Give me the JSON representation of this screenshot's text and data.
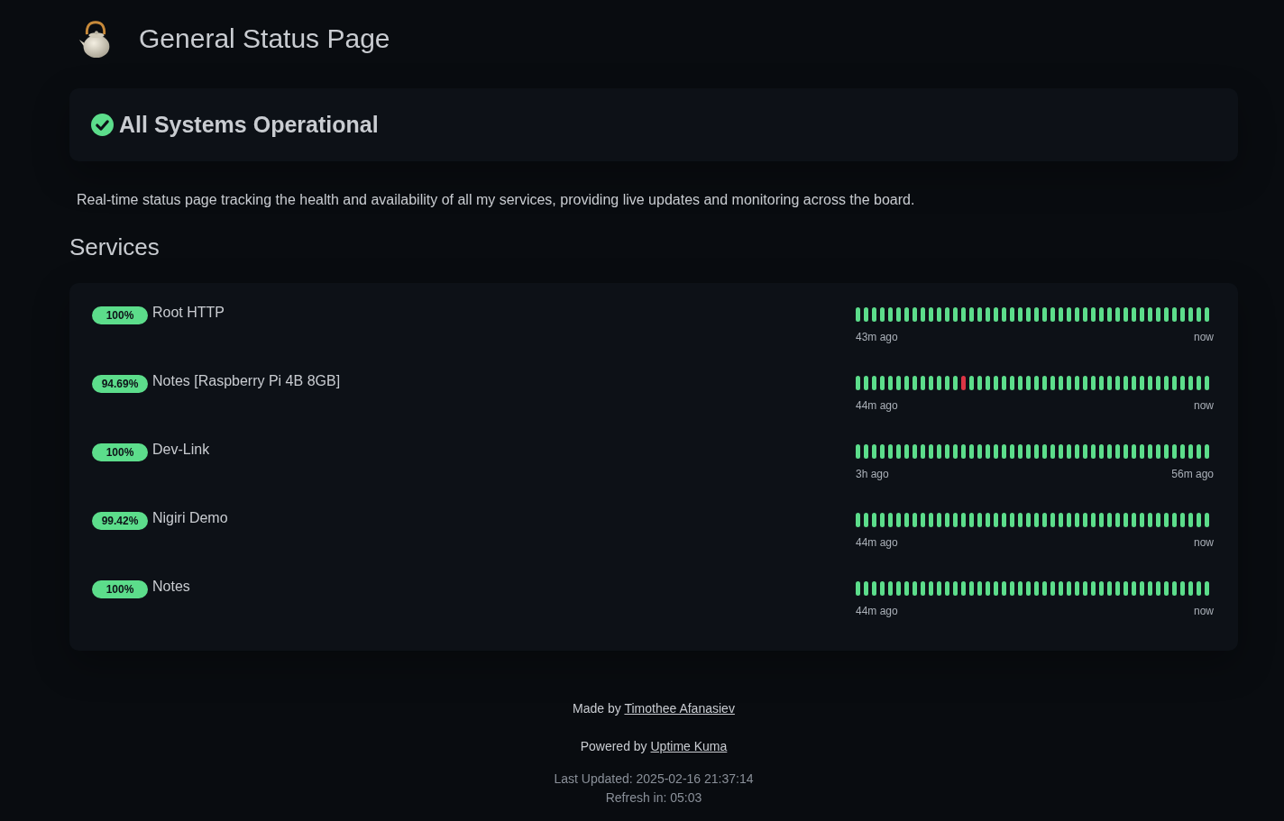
{
  "header": {
    "title": "General Status Page"
  },
  "overall": {
    "operational": true,
    "text": "All Systems Operational"
  },
  "description": "Real-time status page tracking the health and availability of all my services, providing live updates and monitoring across the board.",
  "services_title": "Services",
  "services": [
    {
      "uptime": "100%",
      "name": "Root HTTP",
      "from": "43m ago",
      "to": "now",
      "beats": [
        {
          "up": true
        },
        {
          "up": true
        },
        {
          "up": true
        },
        {
          "up": true
        },
        {
          "up": true
        },
        {
          "up": true
        },
        {
          "up": true
        },
        {
          "up": true
        },
        {
          "up": true
        },
        {
          "up": true
        },
        {
          "up": true
        },
        {
          "up": true
        },
        {
          "up": true
        },
        {
          "up": true
        },
        {
          "up": true
        },
        {
          "up": true
        },
        {
          "up": true
        },
        {
          "up": true
        },
        {
          "up": true
        },
        {
          "up": true
        },
        {
          "up": true
        },
        {
          "up": true
        },
        {
          "up": true
        },
        {
          "up": true
        },
        {
          "up": true
        },
        {
          "up": true
        },
        {
          "up": true
        },
        {
          "up": true
        },
        {
          "up": true
        },
        {
          "up": true
        },
        {
          "up": true
        },
        {
          "up": true
        },
        {
          "up": true
        },
        {
          "up": true
        },
        {
          "up": true
        },
        {
          "up": true
        },
        {
          "up": true
        },
        {
          "up": true
        },
        {
          "up": true
        },
        {
          "up": true
        },
        {
          "up": true
        },
        {
          "up": true
        },
        {
          "up": true
        },
        {
          "up": true
        }
      ]
    },
    {
      "uptime": "94.69%",
      "name": "Notes [Raspberry Pi 4B 8GB]",
      "from": "44m ago",
      "to": "now",
      "beats": [
        {
          "up": true
        },
        {
          "up": true
        },
        {
          "up": true
        },
        {
          "up": true
        },
        {
          "up": true
        },
        {
          "up": true
        },
        {
          "up": true
        },
        {
          "up": true
        },
        {
          "up": true
        },
        {
          "up": true
        },
        {
          "up": true
        },
        {
          "up": true
        },
        {
          "up": true
        },
        {
          "up": false
        },
        {
          "up": true
        },
        {
          "up": true
        },
        {
          "up": true
        },
        {
          "up": true
        },
        {
          "up": true
        },
        {
          "up": true
        },
        {
          "up": true
        },
        {
          "up": true
        },
        {
          "up": true
        },
        {
          "up": true
        },
        {
          "up": true
        },
        {
          "up": true
        },
        {
          "up": true
        },
        {
          "up": true
        },
        {
          "up": true
        },
        {
          "up": true
        },
        {
          "up": true
        },
        {
          "up": true
        },
        {
          "up": true
        },
        {
          "up": true
        },
        {
          "up": true
        },
        {
          "up": true
        },
        {
          "up": true
        },
        {
          "up": true
        },
        {
          "up": true
        },
        {
          "up": true
        },
        {
          "up": true
        },
        {
          "up": true
        },
        {
          "up": true
        },
        {
          "up": true
        }
      ]
    },
    {
      "uptime": "100%",
      "name": "Dev-Link",
      "from": "3h ago",
      "to": "56m ago",
      "beats": [
        {
          "up": true
        },
        {
          "up": true
        },
        {
          "up": true
        },
        {
          "up": true
        },
        {
          "up": true
        },
        {
          "up": true
        },
        {
          "up": true
        },
        {
          "up": true
        },
        {
          "up": true
        },
        {
          "up": true
        },
        {
          "up": true
        },
        {
          "up": true
        },
        {
          "up": true
        },
        {
          "up": true
        },
        {
          "up": true
        },
        {
          "up": true
        },
        {
          "up": true
        },
        {
          "up": true
        },
        {
          "up": true
        },
        {
          "up": true
        },
        {
          "up": true
        },
        {
          "up": true
        },
        {
          "up": true
        },
        {
          "up": true
        },
        {
          "up": true
        },
        {
          "up": true
        },
        {
          "up": true
        },
        {
          "up": true
        },
        {
          "up": true
        },
        {
          "up": true
        },
        {
          "up": true
        },
        {
          "up": true
        },
        {
          "up": true
        },
        {
          "up": true
        },
        {
          "up": true
        },
        {
          "up": true
        },
        {
          "up": true
        },
        {
          "up": true
        },
        {
          "up": true
        },
        {
          "up": true
        },
        {
          "up": true
        },
        {
          "up": true
        },
        {
          "up": true
        },
        {
          "up": true
        }
      ]
    },
    {
      "uptime": "99.42%",
      "name": "Nigiri Demo",
      "from": "44m ago",
      "to": "now",
      "beats": [
        {
          "up": true
        },
        {
          "up": true
        },
        {
          "up": true
        },
        {
          "up": true
        },
        {
          "up": true
        },
        {
          "up": true
        },
        {
          "up": true
        },
        {
          "up": true
        },
        {
          "up": true
        },
        {
          "up": true
        },
        {
          "up": true
        },
        {
          "up": true
        },
        {
          "up": true
        },
        {
          "up": true
        },
        {
          "up": true
        },
        {
          "up": true
        },
        {
          "up": true
        },
        {
          "up": true
        },
        {
          "up": true
        },
        {
          "up": true
        },
        {
          "up": true
        },
        {
          "up": true
        },
        {
          "up": true
        },
        {
          "up": true
        },
        {
          "up": true
        },
        {
          "up": true
        },
        {
          "up": true
        },
        {
          "up": true
        },
        {
          "up": true
        },
        {
          "up": true
        },
        {
          "up": true
        },
        {
          "up": true
        },
        {
          "up": true
        },
        {
          "up": true
        },
        {
          "up": true
        },
        {
          "up": true
        },
        {
          "up": true
        },
        {
          "up": true
        },
        {
          "up": true
        },
        {
          "up": true
        },
        {
          "up": true
        },
        {
          "up": true
        },
        {
          "up": true
        },
        {
          "up": true
        }
      ]
    },
    {
      "uptime": "100%",
      "name": "Notes",
      "from": "44m ago",
      "to": "now",
      "beats": [
        {
          "up": true
        },
        {
          "up": true
        },
        {
          "up": true
        },
        {
          "up": true
        },
        {
          "up": true
        },
        {
          "up": true
        },
        {
          "up": true
        },
        {
          "up": true
        },
        {
          "up": true
        },
        {
          "up": true
        },
        {
          "up": true
        },
        {
          "up": true
        },
        {
          "up": true
        },
        {
          "up": true
        },
        {
          "up": true
        },
        {
          "up": true
        },
        {
          "up": true
        },
        {
          "up": true
        },
        {
          "up": true
        },
        {
          "up": true
        },
        {
          "up": true
        },
        {
          "up": true
        },
        {
          "up": true
        },
        {
          "up": true
        },
        {
          "up": true
        },
        {
          "up": true
        },
        {
          "up": true
        },
        {
          "up": true
        },
        {
          "up": true
        },
        {
          "up": true
        },
        {
          "up": true
        },
        {
          "up": true
        },
        {
          "up": true
        },
        {
          "up": true
        },
        {
          "up": true
        },
        {
          "up": true
        },
        {
          "up": true
        },
        {
          "up": true
        },
        {
          "up": true
        },
        {
          "up": true
        },
        {
          "up": true
        },
        {
          "up": true
        },
        {
          "up": true
        },
        {
          "up": true
        }
      ]
    }
  ],
  "footer": {
    "made_by": {
      "text": "Made by",
      "link": "Timothee Afanasiev"
    },
    "powered_by": {
      "text": "Powered by",
      "link": "Uptime Kuma"
    },
    "last_updated": "Last Updated: 2025-02-16 21:37:14",
    "refresh": "Refresh in: 05:03"
  }
}
